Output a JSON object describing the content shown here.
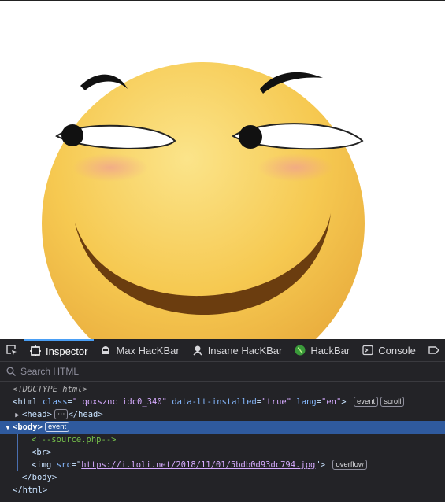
{
  "devtools": {
    "tabs": [
      {
        "label": "Inspector",
        "icon": "inspector-icon",
        "active": true
      },
      {
        "label": "Max HacKBar",
        "icon": "hackbar-max-icon",
        "active": false
      },
      {
        "label": "Insane HacKBar",
        "icon": "hackbar-insane-icon",
        "active": false
      },
      {
        "label": "HackBar",
        "icon": "hackbar-icon",
        "active": false
      },
      {
        "label": "Console",
        "icon": "console-icon",
        "active": false
      }
    ],
    "search_placeholder": "Search HTML",
    "tree": {
      "doctype": "<!DOCTYPE html>",
      "html_open": "<html",
      "html_class_attr": "class",
      "html_class_val": "\" qoxsznc idc0_340\"",
      "html_lt_attr": "data-lt-installed",
      "html_lt_val": "\"true\"",
      "html_lang_attr": "lang",
      "html_lang_val": "\"en\"",
      "html_close_bracket": ">",
      "badge_event": "event",
      "badge_scroll": "scroll",
      "head_open": "<head>",
      "head_ellipsis": "⋯",
      "head_close": "</head>",
      "body_open": "<body>",
      "body_badge": "event",
      "comment": "<!--source.php-->",
      "br": "<br>",
      "img_open": "<img",
      "img_src_attr": "src",
      "img_src_q1": "=\"",
      "img_src_val": "https://i.loli.net/2018/11/01/5bdb0d93dc794.jpg",
      "img_src_q2": "\">",
      "img_badge": "overflow",
      "body_close": "</body>",
      "html_close": "</html>"
    }
  },
  "colors": {
    "face": "#f7c94e",
    "devtools_bg": "#232327",
    "selection": "#2f5a9e",
    "accent": "#4a9ff5"
  }
}
